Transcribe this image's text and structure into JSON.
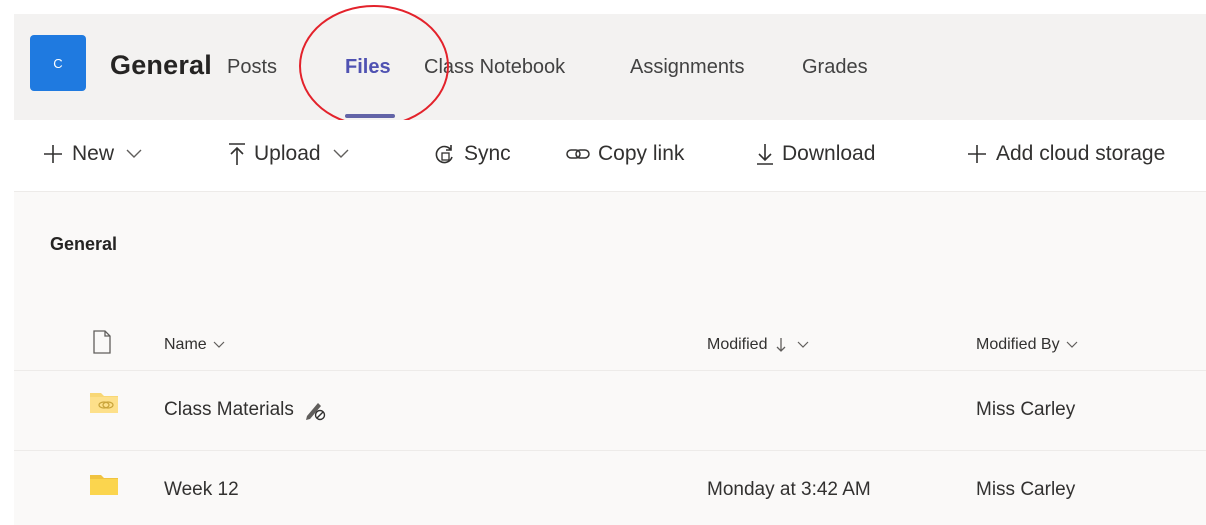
{
  "header": {
    "avatar_letter": "C",
    "channel_title": "General",
    "tabs": [
      {
        "label": "Posts"
      },
      {
        "label": "Files"
      },
      {
        "label": "Class Notebook"
      },
      {
        "label": "Assignments"
      },
      {
        "label": "Grades"
      }
    ],
    "active_tab": "Files",
    "accent_color": "#6264a7",
    "annotation_color": "#e3222b"
  },
  "toolbar": {
    "new_label": "New",
    "upload_label": "Upload",
    "sync_label": "Sync",
    "copy_link_label": "Copy link",
    "download_label": "Download",
    "add_cloud_label": "Add cloud storage"
  },
  "breadcrumb": "General",
  "table": {
    "columns": {
      "name": "Name",
      "modified": "Modified",
      "modified_by": "Modified By"
    },
    "sort": "modified-descending",
    "rows": [
      {
        "name": "Class Materials",
        "icon": "shared-folder-icon",
        "modified": "",
        "modified_by": "Miss Carley",
        "locked": true
      },
      {
        "name": "Week 12",
        "icon": "folder-icon",
        "modified": "Monday at 3:42 AM",
        "modified_by": "Miss Carley",
        "locked": false
      }
    ]
  }
}
